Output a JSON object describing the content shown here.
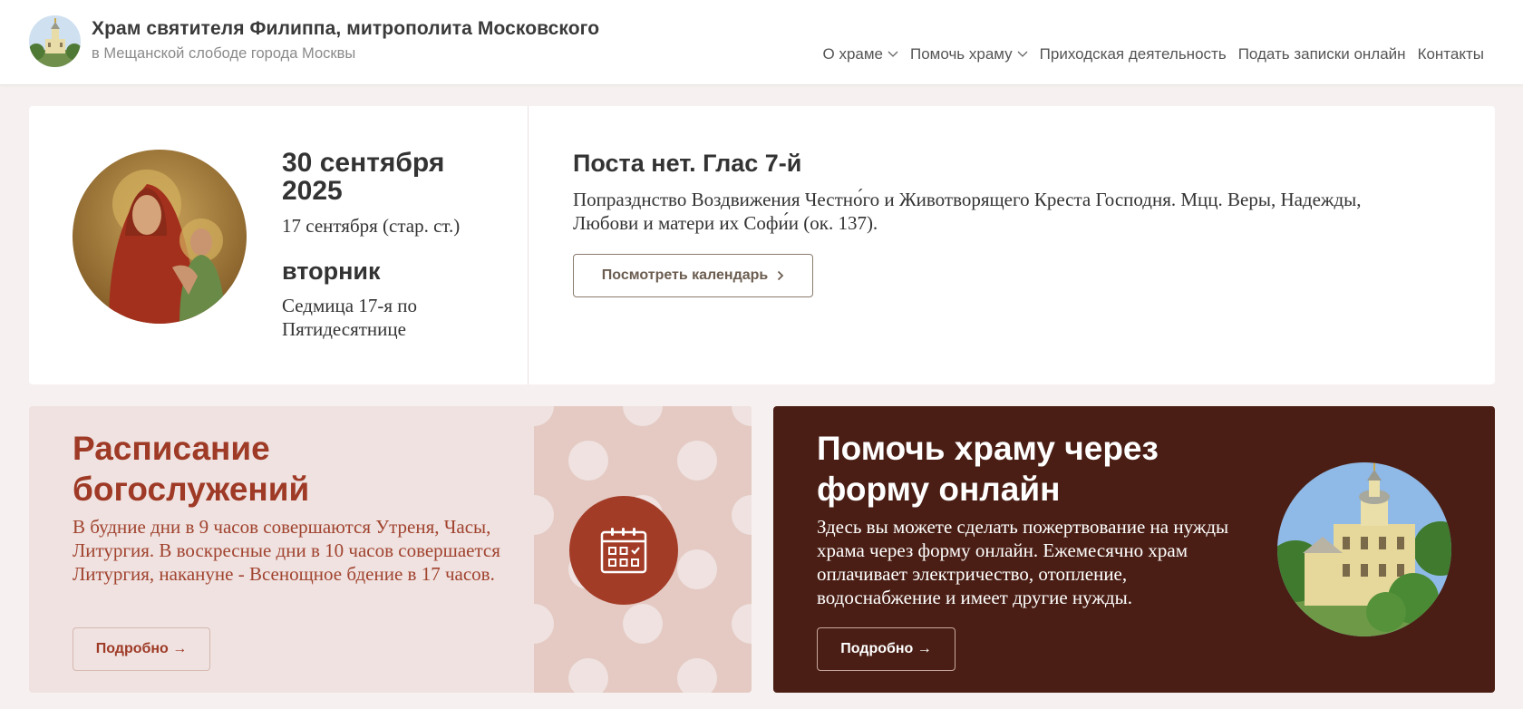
{
  "header": {
    "title": "Храм святителя Филиппа, митрополита Московского",
    "subtitle": "в Мещанской слободе города Москвы",
    "logo_icon": "church-logo-icon",
    "nav": [
      {
        "label": "О храме",
        "has_dropdown": true
      },
      {
        "label": "Помочь храму",
        "has_dropdown": true
      },
      {
        "label": "Приходская деятельность",
        "has_dropdown": false
      },
      {
        "label": "Подать записки онлайн",
        "has_dropdown": false
      },
      {
        "label": "Контакты",
        "has_dropdown": false
      }
    ]
  },
  "date_card": {
    "icon_image": "theotokos-icon-image",
    "date": "30 сентября 2025",
    "old_style_date": "17 сентября (стар. ст.)",
    "weekday": "вторник",
    "week_name": "Седмица 17-я по Пятидесятнице",
    "fast_title": "Поста нет. Глас 7-й",
    "feast_description": "Попразднство Воздвижения Честно́го и Животворящего Креста Господня. Мцц. Веры, Надежды, Любови и матери их Софи́и (ок. 137).",
    "calendar_button": "Посмотреть календарь"
  },
  "schedule_card": {
    "title": "Расписание богослужений",
    "text": "В будние дни в 9 часов совершаются Утреня, Часы, Литургия. В воскресные дни в 10 часов совершается Литургия, накануне - Всенощное бдение в 17 часов.",
    "button": "Подробно →",
    "icon": "calendar-icon"
  },
  "donate_card": {
    "title": "Помочь храму через форму онлайн",
    "text": "Здесь вы можете сделать пожертвование на нужды храма через форму онлайн. Ежемесячно храм оплачивает электричество, отопление, водоснабжение и имеет другие нужды.",
    "button": "Подробно →",
    "image": "church-building-image"
  },
  "colors": {
    "accent": "#9e3a26",
    "dark_card": "#4a1e14",
    "light_card": "#efe2e0",
    "page_bg": "#f6f1f0"
  }
}
